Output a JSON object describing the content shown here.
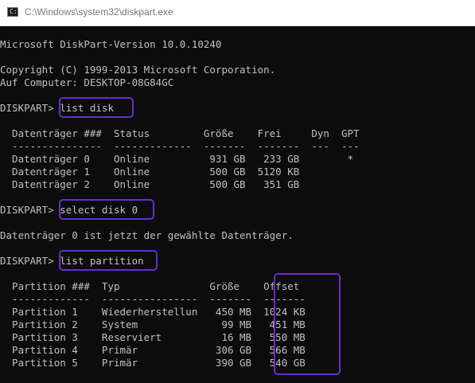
{
  "window": {
    "title": "C:\\Windows\\system32\\diskpart.exe"
  },
  "console": {
    "version_line": "Microsoft DiskPart-Version 10.0.10240",
    "copyright_line": "Copyright (C) 1999-2013 Microsoft Corporation.",
    "computer_line": "Auf Computer: DESKTOP-08G84GC",
    "prompt1": "DISKPART> list disk",
    "disk_header": "  Datenträger ###  Status         Größe    Frei     Dyn  GPT",
    "disk_separator": "  ---------------  -------------  -------  -------  ---  ---",
    "disk_rows": [
      "  Datenträger 0    Online          931 GB   233 GB        *",
      "  Datenträger 1    Online          500 GB  5120 KB",
      "  Datenträger 2    Online          500 GB   351 GB"
    ],
    "prompt2": "DISKPART> select disk 0",
    "select_result": "Datenträger 0 ist jetzt der gewählte Datenträger.",
    "prompt3": "DISKPART> list partition",
    "partition_header": "  Partition ###  Typ               Größe    Offset",
    "partition_separator": "  -------------  ----------------  -------  -------",
    "partition_rows": [
      "  Partition 1    Wiederherstellun   450 MB  1024 KB",
      "  Partition 2    System              99 MB   451 MB",
      "  Partition 3    Reserviert          16 MB   550 MB",
      "  Partition 4    Primär             306 GB   566 MB",
      "  Partition 5    Primär             390 GB   540 GB"
    ]
  },
  "colors": {
    "console_bg": "#0c0c0c",
    "console_text": "#c0c0c0",
    "highlight": "#6a2bd0",
    "titlebar_bg": "#ffffff"
  },
  "icons": {
    "app": "console-app-icon"
  }
}
